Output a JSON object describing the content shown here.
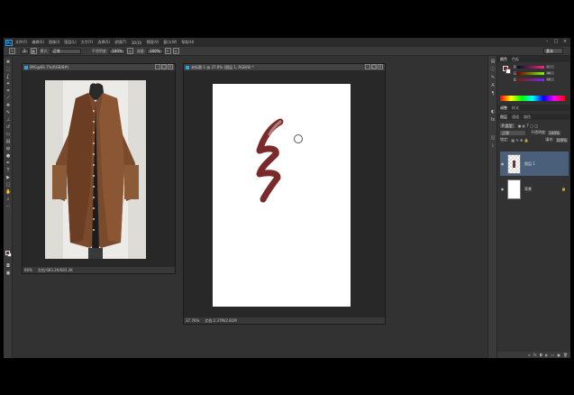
{
  "app": {
    "logo": "Ps",
    "menu": [
      "文件(F)",
      "编辑(E)",
      "图像(I)",
      "图层(L)",
      "文字(Y)",
      "选择(S)",
      "滤镜(T)",
      "3D(D)",
      "视图(V)",
      "窗口(W)",
      "帮助(H)"
    ],
    "window_controls": [
      "–",
      "□",
      "×"
    ]
  },
  "options": {
    "brush_size": "2",
    "mode_label": "模式:",
    "mode_value": "正常",
    "opacity_label": "不透明度:",
    "opacity_value": "100%",
    "flow_label": "流量:",
    "flow_value": "100%",
    "workspace": "基本"
  },
  "documents": [
    {
      "tab": "IMG@66.7%(RGB/8#)",
      "zoom": "66%",
      "status": "文档:683.2K/683.2K"
    },
    {
      "tab": "未标题-1 @ 37.6% (图层 1, RGB/8) *",
      "zoom": "37.76%",
      "status": "文档:2.37M/2.81M"
    }
  ],
  "panels": {
    "color_tabs": [
      "颜色",
      "色板"
    ],
    "color_values": [
      {
        "label": "R",
        "value": "1"
      },
      {
        "label": "G",
        "value": "40"
      },
      {
        "label": "B",
        "value": "15"
      }
    ],
    "adjust_tabs": [
      "调整",
      "样式"
    ],
    "layers_tabs": [
      "图层",
      "通道",
      "路径"
    ],
    "kind_label": "P 类型",
    "blend_mode": "正常",
    "opacity_label": "不透明度:",
    "opacity_value": "100%",
    "lock_label": "锁定:",
    "fill_label": "填充:",
    "fill_value": "100%",
    "layers": [
      {
        "name": "图层 1",
        "selected": true,
        "visible": true
      },
      {
        "name": "背景",
        "selected": false,
        "visible": true,
        "locked": true
      }
    ]
  },
  "colors": {
    "foreground": "#7a2121",
    "background": "#ffffff",
    "stroke": "#7a2a2a",
    "coat": "#7a4a2c",
    "selected_layer": "#4a5f7a"
  },
  "icons": [
    "brush-icon",
    "eye-icon",
    "lock-icon",
    "move-tool-icon",
    "marquee-tool-icon",
    "lasso-tool-icon",
    "crop-tool-icon",
    "eyedropper-tool-icon",
    "brush-tool-icon",
    "eraser-tool-icon",
    "gradient-tool-icon",
    "text-tool-icon",
    "hand-tool-icon",
    "zoom-tool-icon"
  ]
}
